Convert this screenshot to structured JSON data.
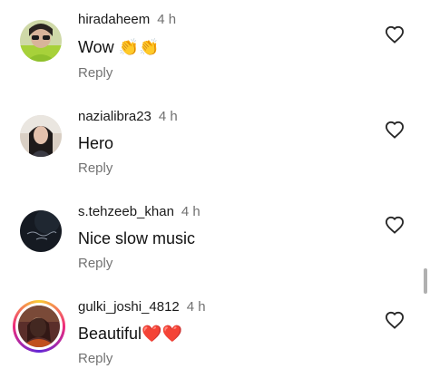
{
  "comments": [
    {
      "username": "hiradaheem",
      "time": "4 h",
      "text": "Wow",
      "emoji": "👏👏",
      "reply_label": "Reply"
    },
    {
      "username": "nazialibra23",
      "time": "4 h",
      "text": "Hero",
      "emoji": "",
      "reply_label": "Reply"
    },
    {
      "username": "s.tehzeeb_khan",
      "time": "4 h",
      "text": "Nice slow music",
      "emoji": "",
      "reply_label": "Reply"
    },
    {
      "username": "gulki_joshi_4812",
      "time": "4 h",
      "text": "Beautiful",
      "emoji": "❤️❤️",
      "reply_label": "Reply"
    }
  ],
  "colors": {
    "username": "#1a1a1a",
    "time": "#707070",
    "reply": "#737373",
    "heart_outline": "#262626",
    "heart_emoji": "#d21919"
  },
  "icons": {
    "like": "heart-outline-icon",
    "clap": "clapping-hands-emoji",
    "heart": "red-heart-emoji"
  }
}
